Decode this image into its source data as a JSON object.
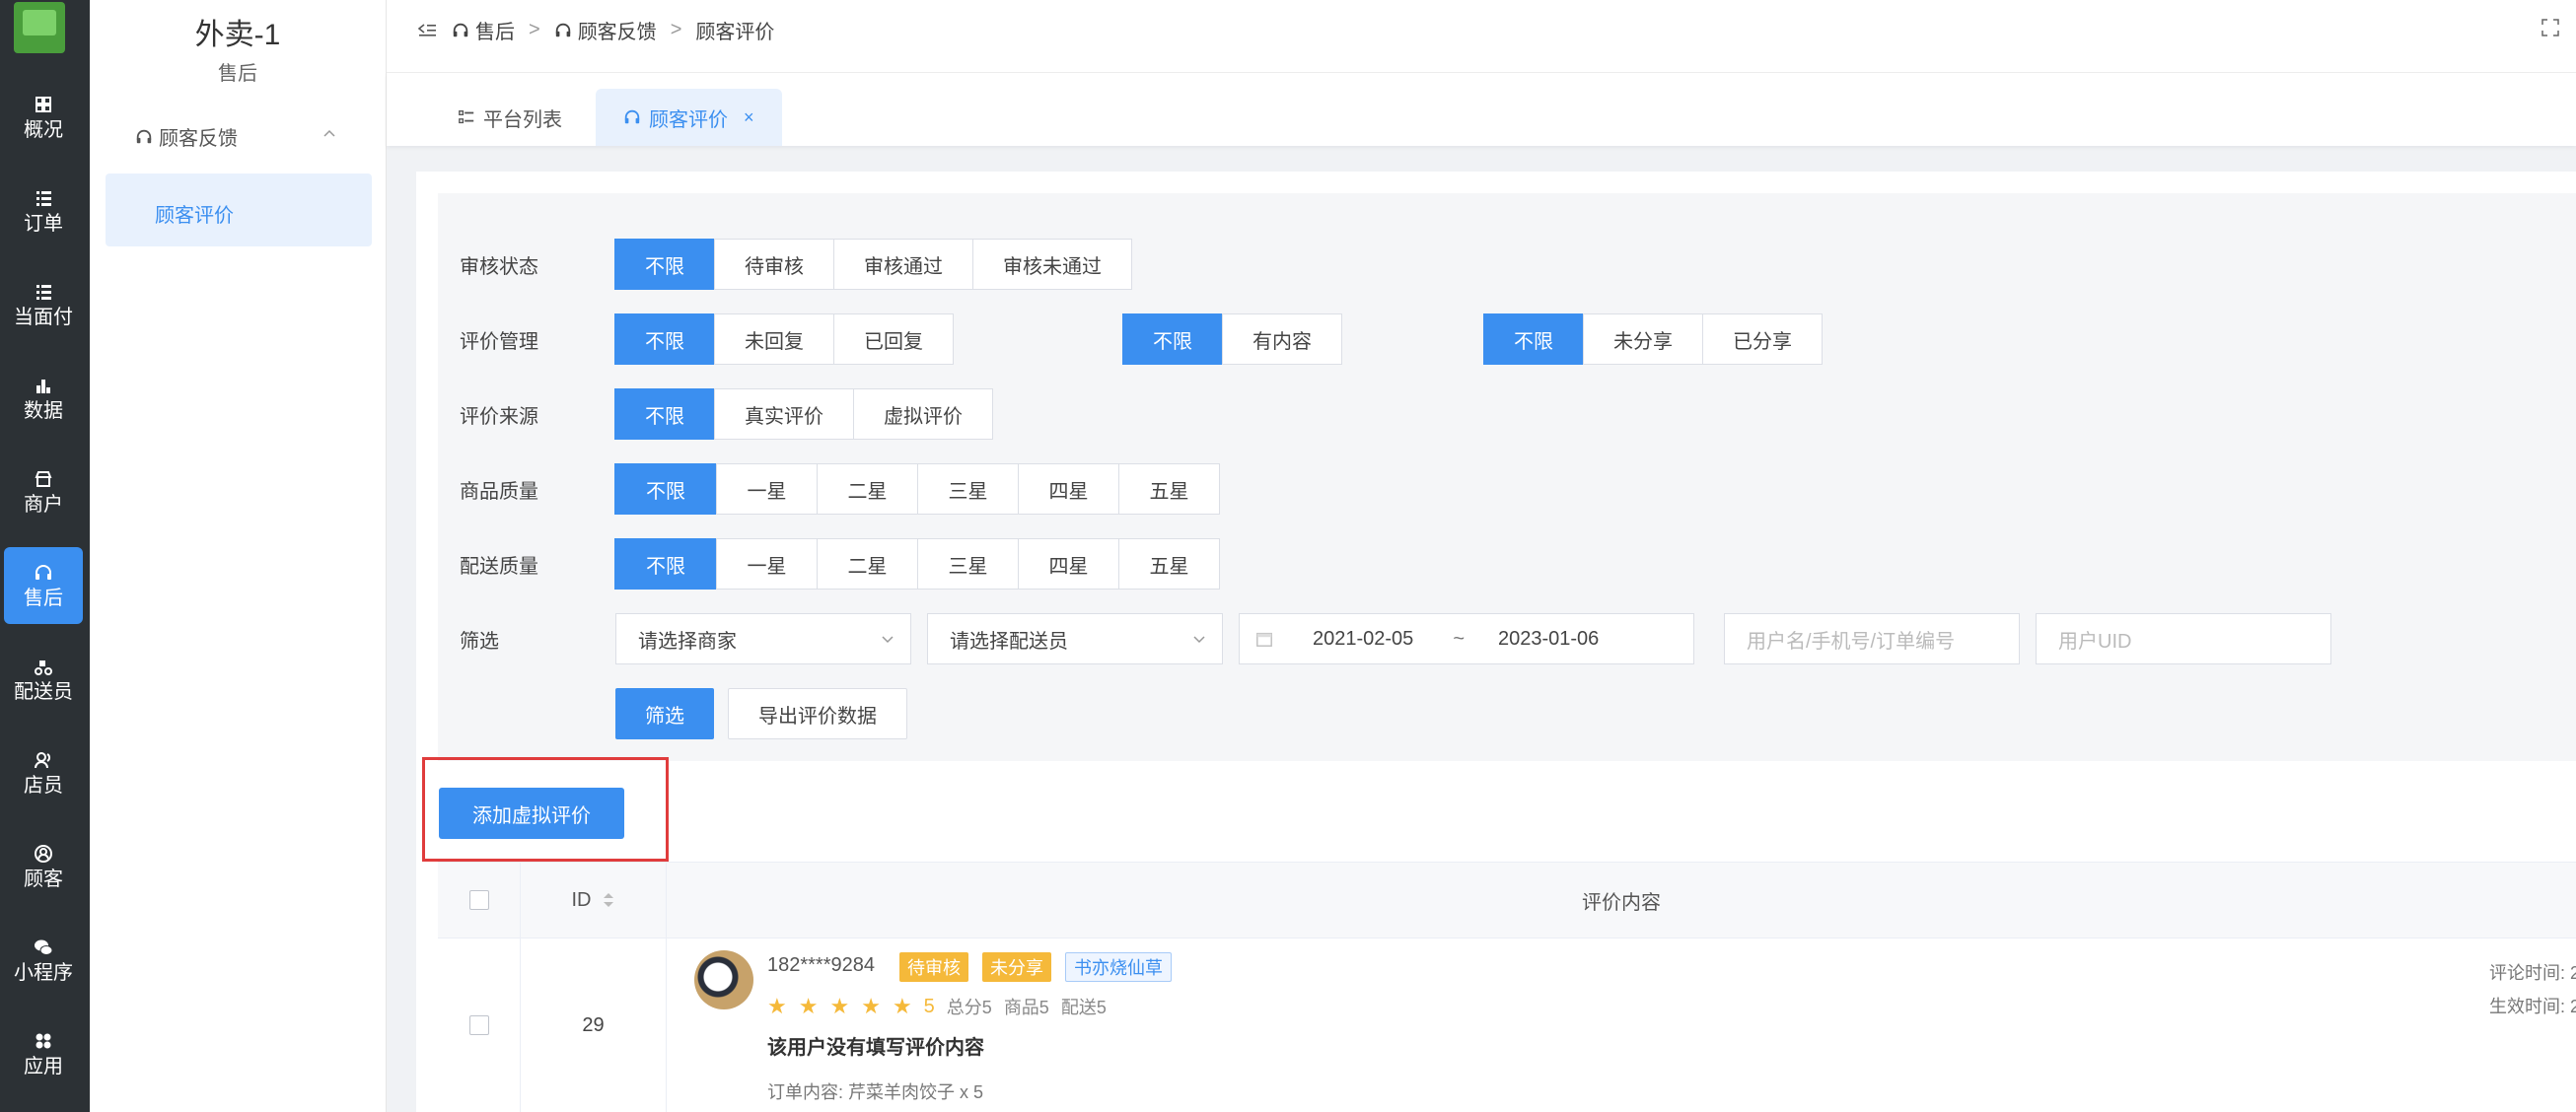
{
  "rail": {
    "items": [
      {
        "label": "概况",
        "icon": "dashboard-icon"
      },
      {
        "label": "订单",
        "icon": "list-icon"
      },
      {
        "label": "当面付",
        "icon": "list-icon"
      },
      {
        "label": "数据",
        "icon": "bar-chart-icon"
      },
      {
        "label": "商户",
        "icon": "shop-icon"
      },
      {
        "label": "售后",
        "icon": "headset-icon",
        "active": true
      },
      {
        "label": "配送员",
        "icon": "delivery-icon"
      },
      {
        "label": "店员",
        "icon": "staff-icon"
      },
      {
        "label": "顾客",
        "icon": "customer-icon"
      },
      {
        "label": "小程序",
        "icon": "wechat-icon"
      },
      {
        "label": "应用",
        "icon": "apps-icon"
      }
    ]
  },
  "subnav": {
    "title": "外卖-1",
    "subtitle": "售后",
    "group": "顾客反馈",
    "active_item": "顾客评价"
  },
  "breadcrumb": [
    "售后",
    "顾客反馈",
    "顾客评价"
  ],
  "tabs": [
    {
      "label": "平台列表"
    },
    {
      "label": "顾客评价",
      "close": "×",
      "active": true
    }
  ],
  "filters": {
    "review_status": {
      "label": "审核状态",
      "options": [
        "不限",
        "待审核",
        "审核通过",
        "审核未通过"
      ]
    },
    "review_manage": {
      "label": "评价管理",
      "options": [
        "不限",
        "未回复",
        "已回复"
      ]
    },
    "content_opts": [
      "不限",
      "有内容"
    ],
    "share_opts": [
      "不限",
      "未分享",
      "已分享"
    ],
    "review_source": {
      "label": "评价来源",
      "options": [
        "不限",
        "真实评价",
        "虚拟评价"
      ]
    },
    "goods_quality": {
      "label": "商品质量",
      "options": [
        "不限",
        "一星",
        "二星",
        "三星",
        "四星",
        "五星"
      ]
    },
    "delivery_quality": {
      "label": "配送质量",
      "options": [
        "不限",
        "一星",
        "二星",
        "三星",
        "四星",
        "五星"
      ]
    },
    "screen": {
      "label": "筛选",
      "merchant_placeholder": "请选择商家",
      "courier_placeholder": "请选择配送员",
      "date_start": "2021-02-05",
      "date_sep": "~",
      "date_end": "2023-01-06",
      "keyword_placeholder": "用户名/手机号/订单编号",
      "uid_placeholder": "用户UID"
    },
    "filter_button": "筛选",
    "export_button": "导出评价数据"
  },
  "add_button": "添加虚拟评价",
  "table": {
    "headers": {
      "id": "ID",
      "content": "评价内容"
    },
    "rows": [
      {
        "id": "29",
        "user": "182****9284",
        "status_tag": "待审核",
        "share_tag": "未分享",
        "shop_tag": "书亦烧仙草",
        "score": "5",
        "total": "总分5",
        "goods": "商品5",
        "delivery": "配送5",
        "comment": "该用户没有填写评价内容",
        "order": "订单内容: 芹菜羊肉饺子 x 5",
        "comment_time_label": "评论时间: 2",
        "effective_time_label": "生效时间: 2"
      }
    ]
  },
  "colors": {
    "primary": "#3b8ff0",
    "rail_bg": "#2c3135",
    "warn": "#f5b93a",
    "highlight_border": "#e03c3c"
  }
}
